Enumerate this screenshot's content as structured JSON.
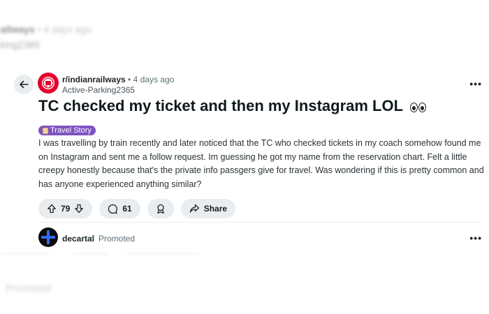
{
  "background": {
    "meta_sub": "ailways",
    "meta_time": "• 4 days ago",
    "user": "king2365",
    "promoted": "Promoted"
  },
  "post": {
    "subreddit": "r/indianrailways",
    "separator": "•",
    "time": "4 days ago",
    "author": "Active-Parking2365",
    "title": "TC checked my ticket and then my Instagram LOL",
    "flair": "Travel Story",
    "body": "I was travelling by train recently and later noticed that the TC who checked tickets in my coach somehow found me on Instagram and sent me a follow request. Im guessing he got my name from the reservation chart. Felt a little creepy honestly because that's the private info passgers give for travel. Was wondering if this is pretty common and has anyone experienced anything similar?",
    "more_icon": "•••"
  },
  "actions": {
    "votes": "79",
    "comments": "61",
    "share_label": "Share"
  },
  "promoted": {
    "name": "decartai",
    "separator": "•",
    "label": "Promoted",
    "more_icon": "•••"
  },
  "colors": {
    "flair_bg": "#7e53c1",
    "subreddit_avatar": "#e4002b",
    "pill_bg": "#eaedef"
  }
}
